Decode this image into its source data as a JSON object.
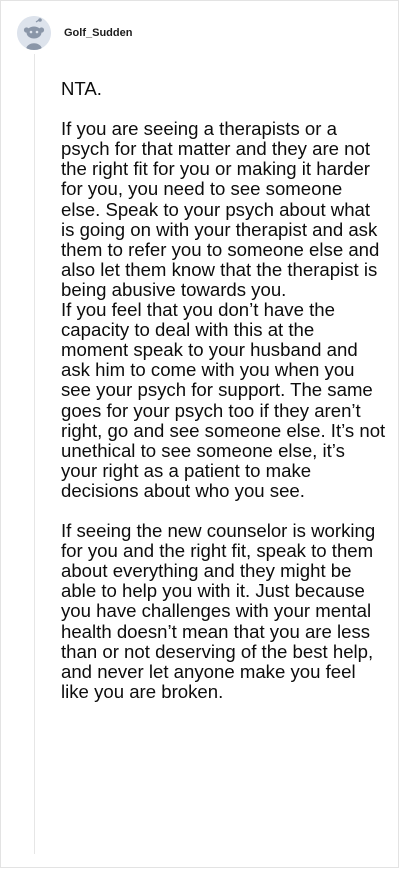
{
  "comment": {
    "author": {
      "username": "Golf_Sudden",
      "avatar_icon": "reddit-snoo-avatar-icon"
    },
    "body": "NTA.\n\nIf you are seeing a therapists or a psych for that matter and they are not the right fit for you or making it harder for you, you need to see someone else. Speak to your psych about what is going on with your therapist and ask them to refer you to someone else and also let them know that the therapist is being abusive towards you.\nIf you feel that you don’t have the capacity to deal with this at the moment speak to your husband and ask him to come with you when you see your psych for support. The same goes for your psych too if they aren’t right, go and see someone else. It’s not unethical to see someone else, it’s your right as a patient to make decisions about who you see.\n\nIf seeing the new counselor is working for you and the right fit, speak to them about everything and they might be able to help you with it. Just because you have challenges with your mental health doesn’t mean that you are less than or not deserving of the best help, and never let anyone make you feel like you are broken."
  },
  "colors": {
    "text": "#0d0d0d",
    "avatar_bg": "#dde3ec",
    "thread_line": "#e6e6e6"
  }
}
